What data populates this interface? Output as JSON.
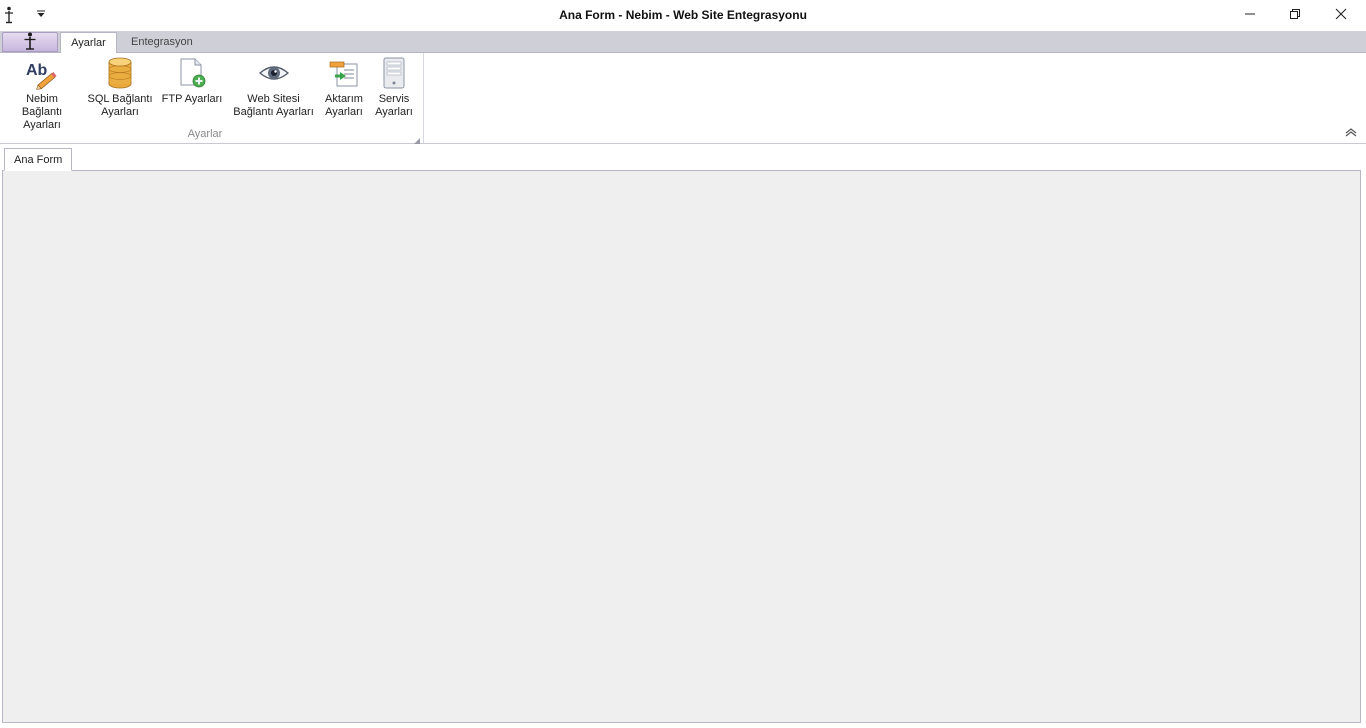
{
  "window": {
    "title": "Ana Form - Nebim - Web Site Entegrasyonu"
  },
  "icons": {
    "app": "stick-figure-logo-icon",
    "qat": "chevron-down-icon",
    "minimize": "minimize-icon",
    "maximize": "restore-icon",
    "close": "close-icon",
    "collapse": "chevron-up-icon"
  },
  "ribbon": {
    "tabs": [
      {
        "label": "Ayarlar",
        "active": true
      },
      {
        "label": "Entegrasyon",
        "active": false
      }
    ],
    "group": {
      "caption": "Ayarlar",
      "buttons": [
        {
          "label": "Nebim Bağlantı\nAyarları",
          "icon": "ab-pencil-icon"
        },
        {
          "label": "SQL Bağlantı\nAyarları",
          "icon": "database-icon"
        },
        {
          "label": "FTP Ayarları",
          "icon": "document-add-icon"
        },
        {
          "label": "Web Sitesi\nBağlantı Ayarları",
          "icon": "eye-icon"
        },
        {
          "label": "Aktarım\nAyarları",
          "icon": "transfer-icon"
        },
        {
          "label": "Servis\nAyarları",
          "icon": "server-icon"
        }
      ]
    }
  },
  "document": {
    "tab_label": "Ana Form"
  },
  "colors": {
    "tabstrip": "#cfcfd8",
    "panel": "#efefef",
    "database_gold": "#e8a93a",
    "ftp_green": "#4caf50"
  }
}
